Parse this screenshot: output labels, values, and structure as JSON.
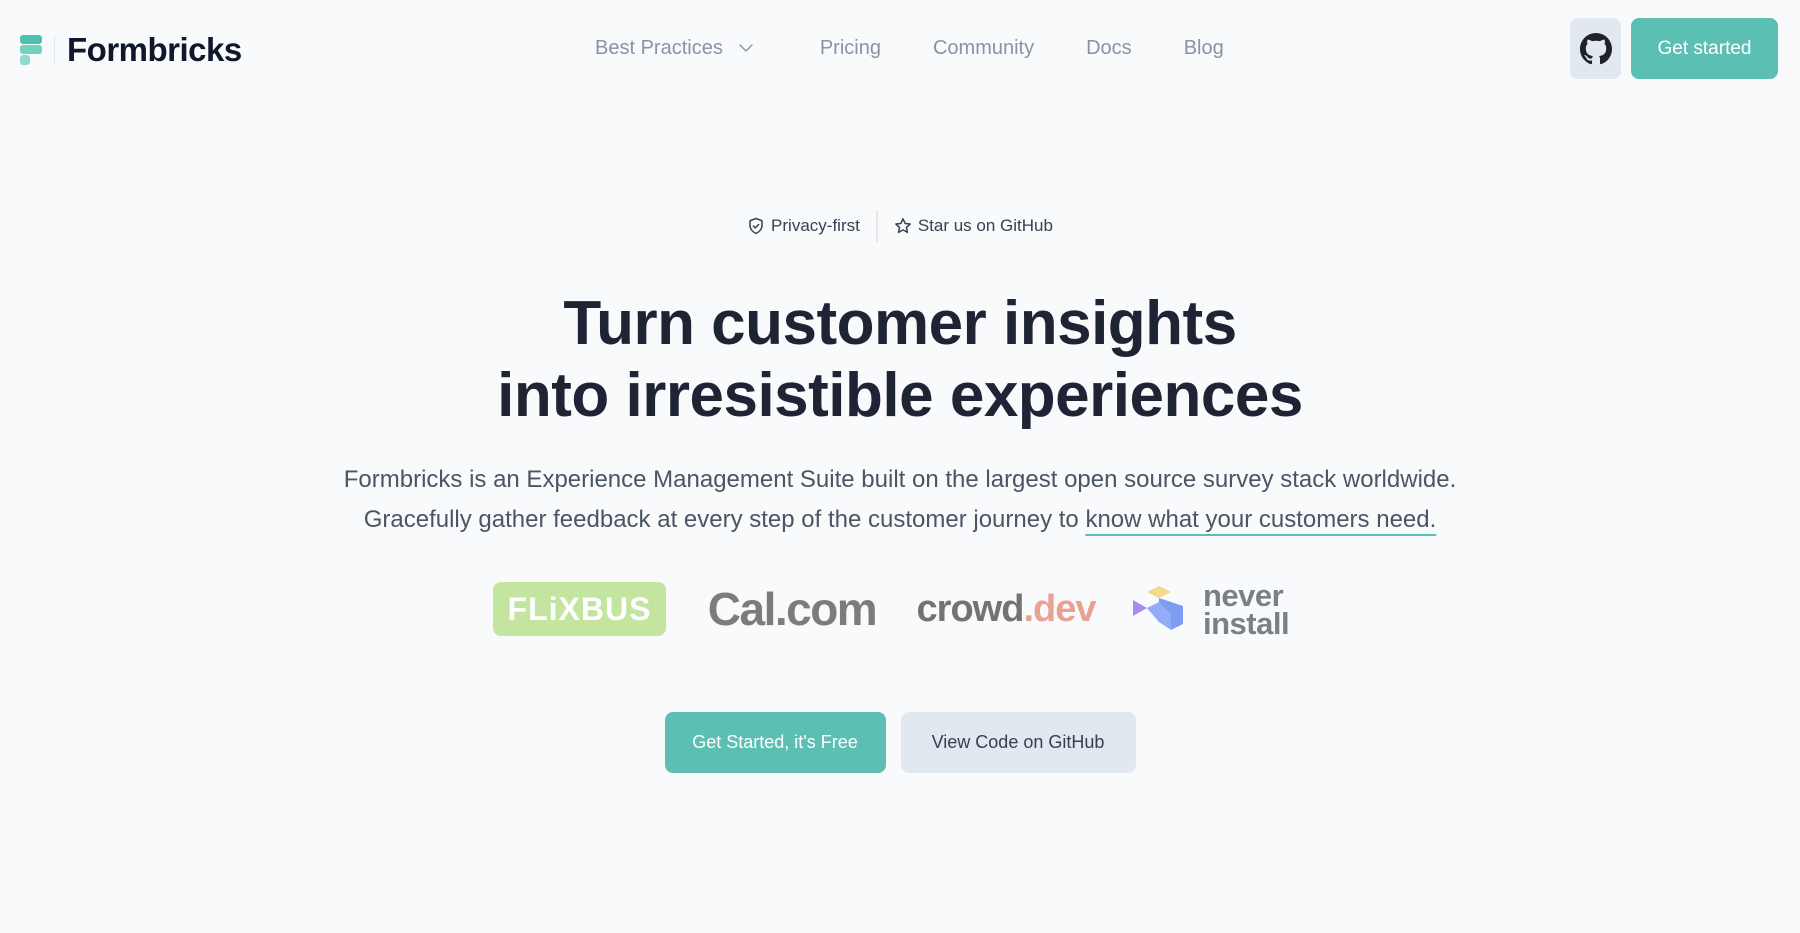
{
  "header": {
    "brand_name": "Formbricks",
    "nav": [
      {
        "label": "Best Practices",
        "has_dropdown": true
      },
      {
        "label": "Pricing"
      },
      {
        "label": "Community"
      },
      {
        "label": "Docs"
      },
      {
        "label": "Blog"
      }
    ],
    "github_icon": "github-icon",
    "cta_label": "Get started"
  },
  "badges": {
    "privacy": {
      "icon": "shield-check-icon",
      "label": "Privacy-first"
    },
    "github": {
      "icon": "star-icon",
      "label": "Star us on GitHub"
    }
  },
  "hero": {
    "headline_line1": "Turn customer insights",
    "headline_line2": "into irresistible experiences",
    "subtitle_line1": "Formbricks is an Experience Management Suite built on the largest open source survey stack worldwide.",
    "subtitle_line2_prefix": "Gracefully gather feedback at every step of the customer journey to ",
    "subtitle_line2_highlight": "know what your customers need."
  },
  "logos": {
    "flixbus": "FLiXBUS",
    "calcom": "Cal.com",
    "crowddev_part1": "crowd",
    "crowddev_part2": ".dev",
    "neverinstall_line1": "never",
    "neverinstall_line2": "install"
  },
  "ctas": {
    "primary": "Get Started, it's Free",
    "secondary": "View Code on GitHub"
  },
  "colors": {
    "accent": "#5bbfb3",
    "background": "#f8fafc",
    "secondary_button": "#e2e8f0",
    "heading": "#1e2433"
  }
}
